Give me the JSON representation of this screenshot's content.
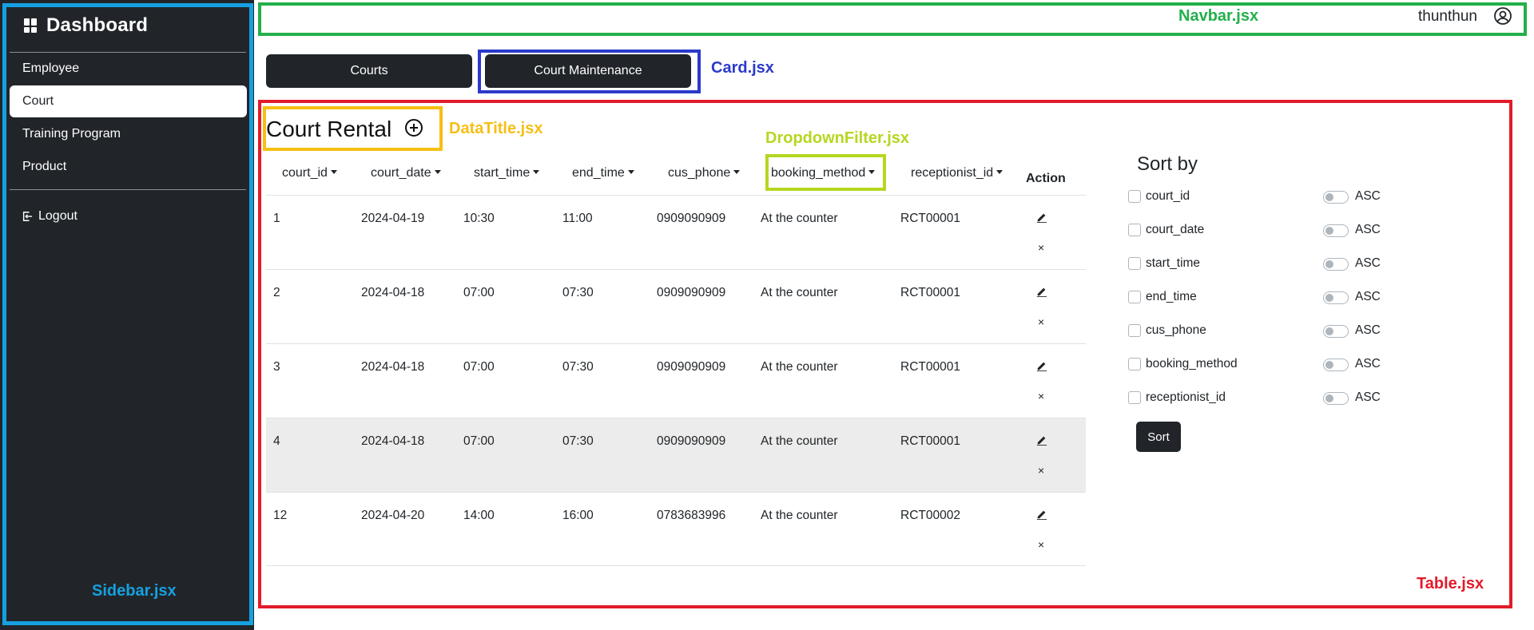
{
  "sidebar": {
    "brand": "Dashboard",
    "items": [
      {
        "label": "Employee"
      },
      {
        "label": "Court"
      },
      {
        "label": "Training Program"
      },
      {
        "label": "Product"
      }
    ],
    "logout": "Logout",
    "component_label": "Sidebar.jsx",
    "component_color": "#16a0e0"
  },
  "navbar": {
    "component_label": "Navbar.jsx",
    "username": "thunthun",
    "component_color": "#22b04a"
  },
  "cards": {
    "buttons": [
      "Courts",
      "Court Maintenance"
    ],
    "component_label": "Card.jsx",
    "component_color": "#2b3aca"
  },
  "data_title": {
    "title": "Court Rental",
    "component_label": "DataTitle.jsx",
    "component_color": "#f6bf15"
  },
  "dropdown_filter": {
    "component_label": "DropdownFilter.jsx",
    "component_color": "#b5d721"
  },
  "table": {
    "component_label": "Table.jsx",
    "component_color": "#e21b2a",
    "columns": [
      "court_id",
      "court_date",
      "start_time",
      "end_time",
      "cus_phone",
      "booking_method",
      "receptionist_id"
    ],
    "action_header": "Action",
    "rows": [
      [
        "1",
        "2024-04-19",
        "10:30",
        "11:00",
        "0909090909",
        "At the counter",
        "RCT00001"
      ],
      [
        "2",
        "2024-04-18",
        "07:00",
        "07:30",
        "0909090909",
        "At the counter",
        "RCT00001"
      ],
      [
        "3",
        "2024-04-18",
        "07:00",
        "07:30",
        "0909090909",
        "At the counter",
        "RCT00001"
      ],
      [
        "4",
        "2024-04-18",
        "07:00",
        "07:30",
        "0909090909",
        "At the counter",
        "RCT00001"
      ],
      [
        "12",
        "2024-04-20",
        "14:00",
        "16:00",
        "0783683996",
        "At the counter",
        "RCT00002"
      ]
    ],
    "delete_glyph": "×"
  },
  "sort": {
    "title": "Sort by",
    "fields": [
      "court_id",
      "court_date",
      "start_time",
      "end_time",
      "cus_phone",
      "booking_method",
      "receptionist_id"
    ],
    "order_label": "ASC",
    "button": "Sort"
  },
  "colors": {
    "dark": "#212529",
    "highlight_row": "#ececec"
  }
}
